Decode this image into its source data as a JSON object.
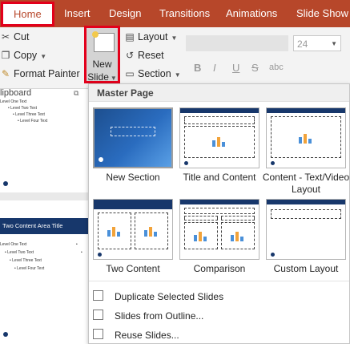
{
  "tabs": [
    "Home",
    "Insert",
    "Design",
    "Transitions",
    "Animations",
    "Slide Show"
  ],
  "clipboard": {
    "cut": "Cut",
    "copy": "Copy",
    "format_painter": "Format Painter",
    "group_label": "lipboard"
  },
  "slides": {
    "new_line1": "New",
    "new_line2": "Slide",
    "layout": "Layout",
    "reset": "Reset",
    "section": "Section"
  },
  "font": {
    "size": "24",
    "bold": "B",
    "italic": "I",
    "underline": "U",
    "strike": "S",
    "abc": "abc"
  },
  "slide_pane": {
    "thumb1_lines": [
      "Level One Text",
      "• Level Two Text",
      "• Level Three Text",
      "• Level Four Text"
    ],
    "thumb2_title": "Two Content Area Title",
    "thumb2_left": [
      "Level One Text",
      "• Level Two Text",
      "• Level Three Text",
      "• Level Four Text"
    ],
    "thumb2_right": [
      "•",
      "•"
    ]
  },
  "gallery": {
    "header": "Master Page",
    "layouts": [
      "New Section",
      "Title and Content",
      "Content - Text/Video Layout",
      "Two Content",
      "Comparison",
      "Custom Layout"
    ],
    "menu": [
      "Duplicate Selected Slides",
      "Slides from Outline...",
      "Reuse Slides..."
    ]
  },
  "colors": {
    "accent": "#b7472a",
    "highlight": "#e3001b",
    "navy": "#17376b"
  }
}
